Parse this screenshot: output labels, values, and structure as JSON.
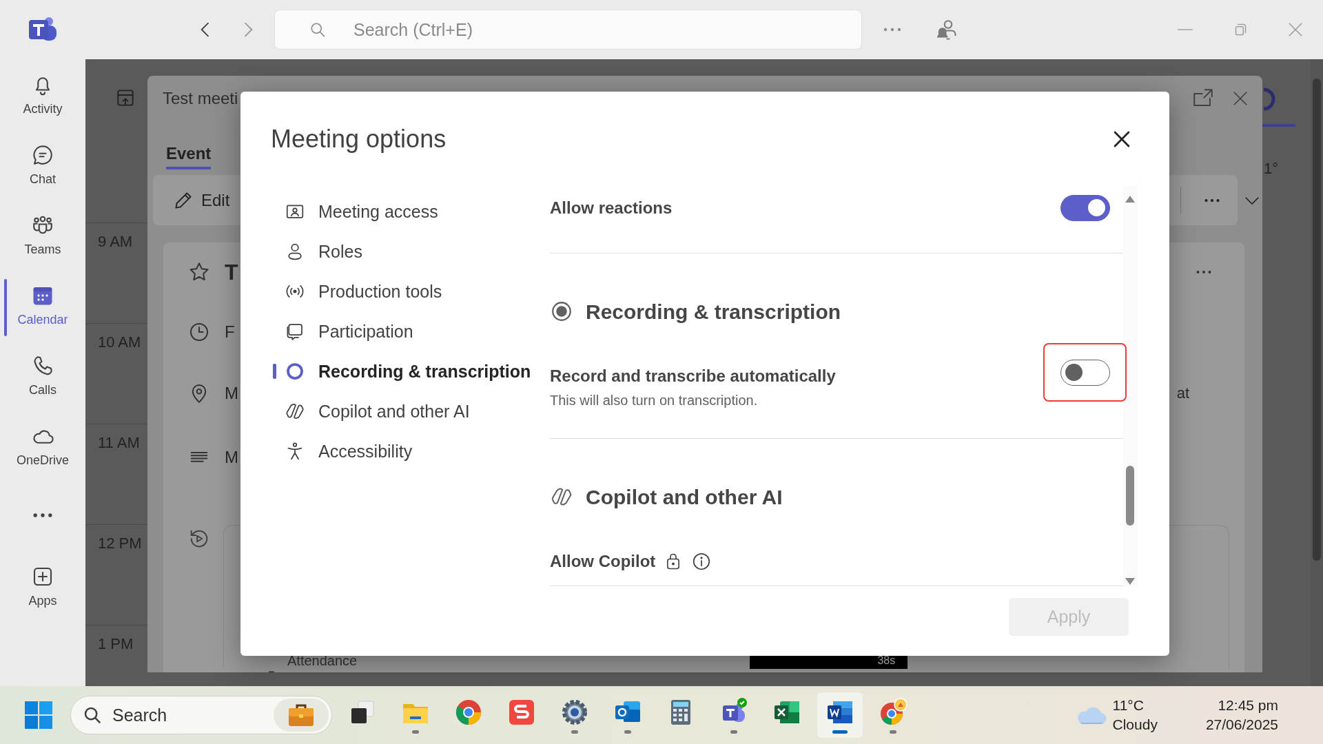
{
  "titlebar": {
    "search": {
      "placeholder": "Search (Ctrl+E)"
    }
  },
  "rail": {
    "items": [
      {
        "label": "Activity",
        "selected": false
      },
      {
        "label": "Chat",
        "selected": false
      },
      {
        "label": "Teams",
        "selected": false
      },
      {
        "label": "Calendar",
        "selected": true
      },
      {
        "label": "Calls",
        "selected": false
      },
      {
        "label": "OneDrive",
        "selected": false
      }
    ],
    "apps_button": {
      "label": "Apps"
    }
  },
  "calendar": {
    "hours": [
      "9 AM",
      "10 AM",
      "11 AM",
      "12 PM",
      "1 PM"
    ],
    "side_text": "1°",
    "event": {
      "title": "Test meeti",
      "tabs": [
        {
          "label": "Event",
          "selected": true
        }
      ],
      "edit_button": "Edit",
      "details": [
        "T",
        "F",
        "M",
        "M"
      ],
      "side_text": "at",
      "attendance": "Attendance",
      "video_time": "38s"
    }
  },
  "dialog": {
    "title": "Meeting options",
    "nav": [
      {
        "label": "Meeting access",
        "selected": false
      },
      {
        "label": "Roles",
        "selected": false
      },
      {
        "label": "Production tools",
        "selected": false
      },
      {
        "label": "Participation",
        "selected": false
      },
      {
        "label": "Recording & transcription",
        "selected": true
      },
      {
        "label": "Copilot and other AI",
        "selected": false
      },
      {
        "label": "Accessibility",
        "selected": false
      }
    ],
    "settings": [
      {
        "kind": "toggle",
        "label": "Allow reactions",
        "on": true,
        "highlighted": false
      },
      {
        "kind": "section",
        "label": "Recording & transcription"
      },
      {
        "kind": "toggle",
        "label": "Record and transcribe automatically",
        "description": "This will also turn on transcription.",
        "on": false,
        "highlighted": true
      },
      {
        "kind": "section",
        "label": "Copilot and other AI"
      },
      {
        "kind": "locked",
        "label": "Allow Copilot"
      }
    ],
    "apply": {
      "label": "Apply",
      "disabled": true
    }
  },
  "taskbar": {
    "search": {
      "placeholder": "Search"
    },
    "apps": [
      {
        "running": false,
        "selected": false
      },
      {
        "running": true,
        "selected": false
      },
      {
        "running": false,
        "selected": false
      },
      {
        "running": false,
        "selected": false
      },
      {
        "running": true,
        "selected": false
      },
      {
        "running": true,
        "selected": false
      },
      {
        "running": false,
        "selected": false
      },
      {
        "running": true,
        "selected": false
      },
      {
        "running": false,
        "selected": false
      },
      {
        "running": true,
        "selected": true
      },
      {
        "running": true,
        "selected": false
      }
    ],
    "weather": {
      "temperature": "11°C",
      "condition": "Cloudy"
    },
    "clock": {
      "time": "12:45 pm",
      "date": "27/06/2025"
    }
  }
}
